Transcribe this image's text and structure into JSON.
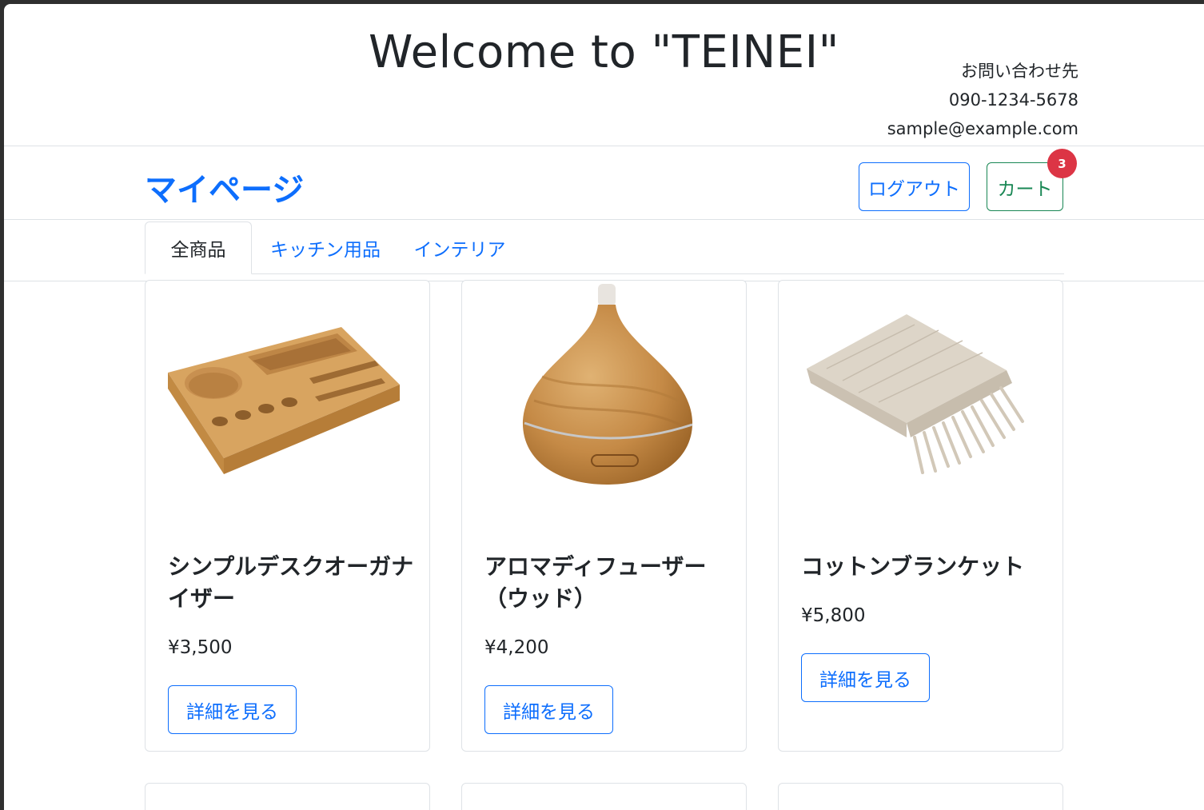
{
  "header": {
    "title": "Welcome to \"TEINEI\"",
    "contact_label": "お問い合わせ先",
    "phone": "090-1234-5678",
    "email": "sample@example.com"
  },
  "navbar": {
    "brand": "マイページ",
    "logout_label": "ログアウト",
    "cart_label": "カート",
    "cart_count": "3"
  },
  "tabs": [
    {
      "label": "全商品",
      "active": true
    },
    {
      "label": "キッチン用品",
      "active": false
    },
    {
      "label": "インテリア",
      "active": false
    }
  ],
  "products": [
    {
      "name": "シンプルデスクオーガナイザー",
      "price": "¥3,500",
      "button": "詳細を見る",
      "image": "wooden-desk-organizer"
    },
    {
      "name": "アロマディフューザー（ウッド）",
      "price": "¥4,200",
      "button": "詳細を見る",
      "image": "wood-aroma-diffuser"
    },
    {
      "name": "コットンブランケット",
      "price": "¥5,800",
      "button": "詳細を見る",
      "image": "folded-cotton-blanket"
    }
  ]
}
